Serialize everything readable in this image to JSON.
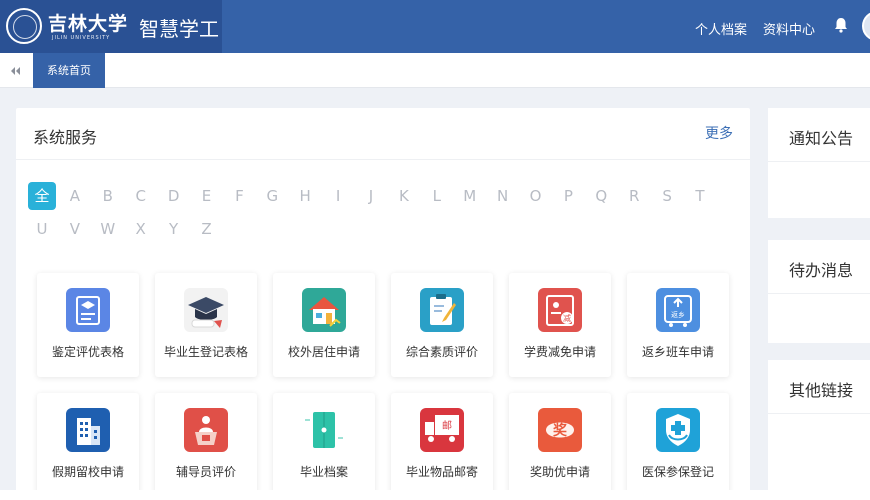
{
  "header": {
    "university_name": "吉林大学",
    "university_sub": "JILIN UNIVERSITY",
    "app_title": "智慧学工",
    "nav": [
      "个人档案",
      "资料中心"
    ],
    "bell_icon": "bell-icon"
  },
  "tabs": {
    "back_icon": "double-chevron-left-icon",
    "active_label": "系统首页"
  },
  "services": {
    "title": "系统服务",
    "more_label": "更多",
    "letters": [
      "全",
      "A",
      "B",
      "C",
      "D",
      "E",
      "F",
      "G",
      "H",
      "I",
      "J",
      "K",
      "L",
      "M",
      "N",
      "O",
      "P",
      "Q",
      "R",
      "S",
      "T",
      "U",
      "V",
      "W",
      "X",
      "Y",
      "Z"
    ],
    "active_letter": "全",
    "items": [
      {
        "label": "鉴定评优表格",
        "icon": "graduate-form-icon",
        "color": "#5b86e5"
      },
      {
        "label": "毕业生登记表格",
        "icon": "graduation-cap-icon",
        "color": "#3b4a66"
      },
      {
        "label": "校外居住申请",
        "icon": "house-icon",
        "color": "#2fa898"
      },
      {
        "label": "综合素质评价",
        "icon": "clipboard-pen-icon",
        "color": "#2aa0c7"
      },
      {
        "label": "学费减免申请",
        "icon": "fee-certificate-icon",
        "color": "#e0534e"
      },
      {
        "label": "返乡班车申请",
        "icon": "bus-icon",
        "color": "#4d8fe0"
      },
      {
        "label": "假期留校申请",
        "icon": "building-icon",
        "color": "#1f5fb0"
      },
      {
        "label": "辅导员评价",
        "icon": "lectern-icon",
        "color": "#e05048"
      },
      {
        "label": "毕业档案",
        "icon": "archive-envelope-icon",
        "color": "#2dc2a8"
      },
      {
        "label": "毕业物品邮寄",
        "icon": "mail-truck-icon",
        "color": "#d9363e"
      },
      {
        "label": "奖助优申请",
        "icon": "award-icon",
        "color": "#e95a3c"
      },
      {
        "label": "医保参保登记",
        "icon": "medical-insurance-icon",
        "color": "#1fa2d8"
      }
    ],
    "badge_texts": {
      "fee": "减",
      "bus": "返乡",
      "mail": "邮",
      "award": "奖"
    }
  },
  "panels": [
    {
      "title": "通知公告"
    },
    {
      "title": "待办消息"
    },
    {
      "title": "其他链接"
    }
  ]
}
